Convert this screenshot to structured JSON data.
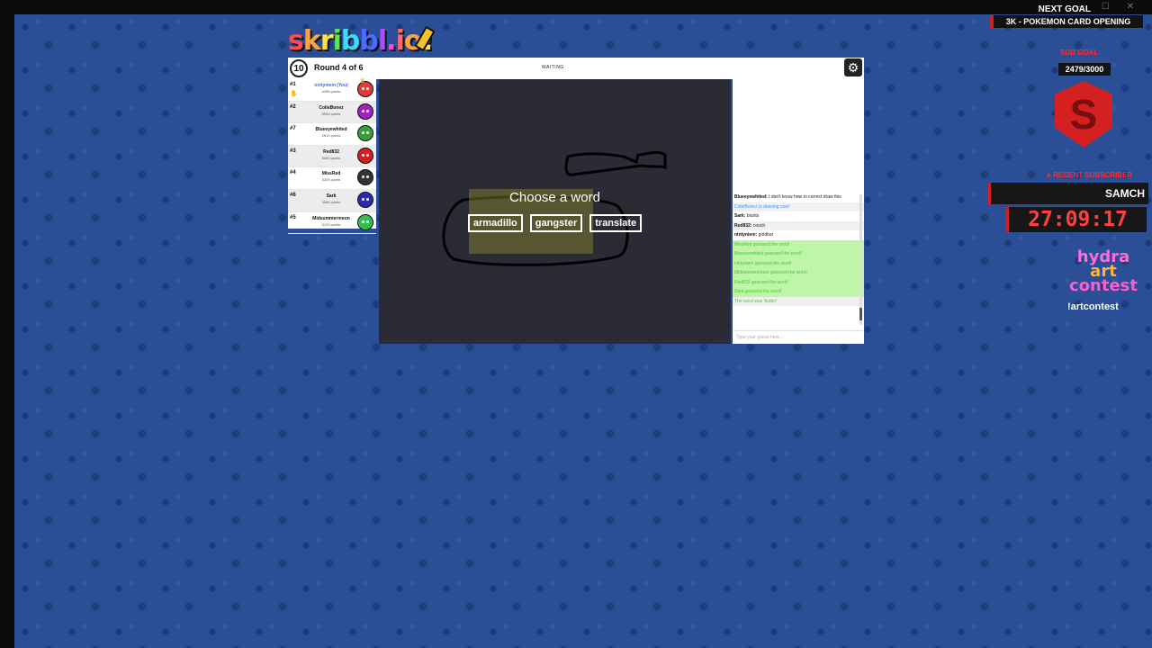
{
  "window": {
    "controls": "— ☐ ✕"
  },
  "logo": {
    "letters": [
      "s",
      "k",
      "r",
      "i",
      "b",
      "b",
      "l",
      ".",
      "i",
      "o",
      "!"
    ]
  },
  "header": {
    "timer": "10",
    "round": "Round 4 of 6",
    "status": "WAITING",
    "settings_icon": "gear-icon"
  },
  "players": [
    {
      "rank": "#1",
      "name": "nintyniem (You)",
      "points": "6385 points",
      "color": "#e03a3a",
      "you": true
    },
    {
      "rank": "#2",
      "name": "ColieBonez",
      "points": "5940 points",
      "color": "#a21fc4"
    },
    {
      "rank": "#7",
      "name": "Blueeyewhited",
      "points": "2610 points",
      "color": "#3a9d3a"
    },
    {
      "rank": "#3",
      "name": "Red832",
      "points": "5450 points",
      "color": "#d42020"
    },
    {
      "rank": "#4",
      "name": "MissRed",
      "points": "5305 points",
      "color": "#333333"
    },
    {
      "rank": "#6",
      "name": "Sark",
      "points": "4565 points",
      "color": "#2a2ab0"
    },
    {
      "rank": "#5",
      "name": "Midsummermoon",
      "points": "5120 points",
      "color": "#2fbf4f"
    }
  ],
  "overlay": {
    "title": "Choose a word",
    "words": [
      "armadillo",
      "gangster",
      "translate"
    ]
  },
  "chat": {
    "messages": [
      {
        "name": "Blueeyewhited:",
        "text": "I don't know how to correct draw this",
        "style": "normal"
      },
      {
        "name": "",
        "text": "ColieBonez is drawing now!",
        "style": "blue"
      },
      {
        "name": "Sark:",
        "text": "blunts",
        "style": "normal"
      },
      {
        "name": "Red832:",
        "text": "couch",
        "style": "normal"
      },
      {
        "name": "nintyniem:",
        "text": "goldbar",
        "style": "normal"
      },
      {
        "name": "",
        "text": "MissRed guessed the word!",
        "style": "green"
      },
      {
        "name": "",
        "text": "Blueeyewhited guessed the word!",
        "style": "green"
      },
      {
        "name": "",
        "text": "nintyniem guessed the word!",
        "style": "green"
      },
      {
        "name": "",
        "text": "Midsummermoon guessed the word!",
        "style": "green"
      },
      {
        "name": "",
        "text": "Red832 guessed the word!",
        "style": "green"
      },
      {
        "name": "",
        "text": "Sark guessed the word!",
        "style": "green"
      },
      {
        "name": "",
        "text": "The word was 'butter'",
        "style": "orange"
      }
    ],
    "input_placeholder": "Type your guess here..."
  },
  "stream": {
    "next_goal_label": "NEXT GOAL",
    "next_goal": "3K - POKEMON CARD OPENING",
    "sub_goal_label": "SUB GOAL",
    "sub_goal_count": "2479/3000",
    "recent_sub_label": "▸ RECENT SUBSCRIBER",
    "recent_sub_name": "SAMCH",
    "timer": "27:09:17",
    "contest_words": [
      "hydra",
      "art",
      "contest"
    ],
    "contest_command": "!artcontest"
  }
}
